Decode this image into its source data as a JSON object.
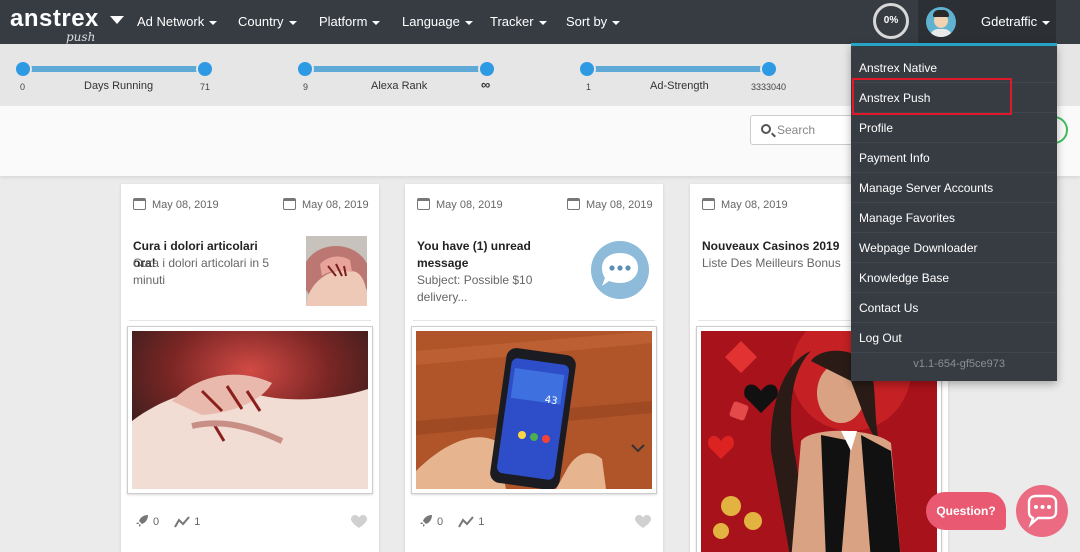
{
  "brand": {
    "name": "anstrex",
    "sub": "push"
  },
  "nav": [
    {
      "label": "Ad Network"
    },
    {
      "label": "Country"
    },
    {
      "label": "Platform"
    },
    {
      "label": "Language"
    },
    {
      "label": "Tracker"
    },
    {
      "label": "Sort by"
    }
  ],
  "progress": "0%",
  "user": {
    "name": "Gdetraffic"
  },
  "filters": [
    {
      "label": "Days Running",
      "min": "0",
      "max": "71"
    },
    {
      "label": "Alexa Rank",
      "min": "9",
      "max": "∞"
    },
    {
      "label": "Ad-Strength",
      "min": "1",
      "max": "3333040"
    }
  ],
  "search": {
    "placeholder": "Search"
  },
  "cards": [
    {
      "date_left": "May 08, 2019",
      "date_right": "May 08, 2019",
      "title": "Cura i dolori articolari ora!",
      "body": "Cura i dolori articolari in 5 minuti",
      "rocket_count": "0",
      "trend_count": "1"
    },
    {
      "date_left": "May 08, 2019",
      "date_right": "May 08, 2019",
      "title": "You have (1) unread message",
      "body": "Subject: Possible $10 delivery...",
      "rocket_count": "0",
      "trend_count": "1"
    },
    {
      "date_left": "May 08, 2019",
      "title": "Nouveaux Casinos 2019",
      "body": "Liste Des Meilleurs Bonus"
    }
  ],
  "menu": {
    "items": [
      {
        "label": "Anstrex Native"
      },
      {
        "label": "Anstrex Push"
      },
      {
        "label": "Profile"
      },
      {
        "label": "Payment Info"
      },
      {
        "label": "Manage Server Accounts"
      },
      {
        "label": "Manage Favorites"
      },
      {
        "label": "Webpage Downloader"
      },
      {
        "label": "Knowledge Base"
      },
      {
        "label": "Contact Us"
      },
      {
        "label": "Log Out"
      }
    ],
    "version": "v1.1-654-gf5ce973"
  },
  "help": {
    "question_label": "Question?"
  },
  "colors": {
    "topbar": "#373c43",
    "slider": "#2e9ae3",
    "menu_accent": "#26a3c6",
    "highlight": "#e0192a",
    "help": "#e95a72"
  }
}
